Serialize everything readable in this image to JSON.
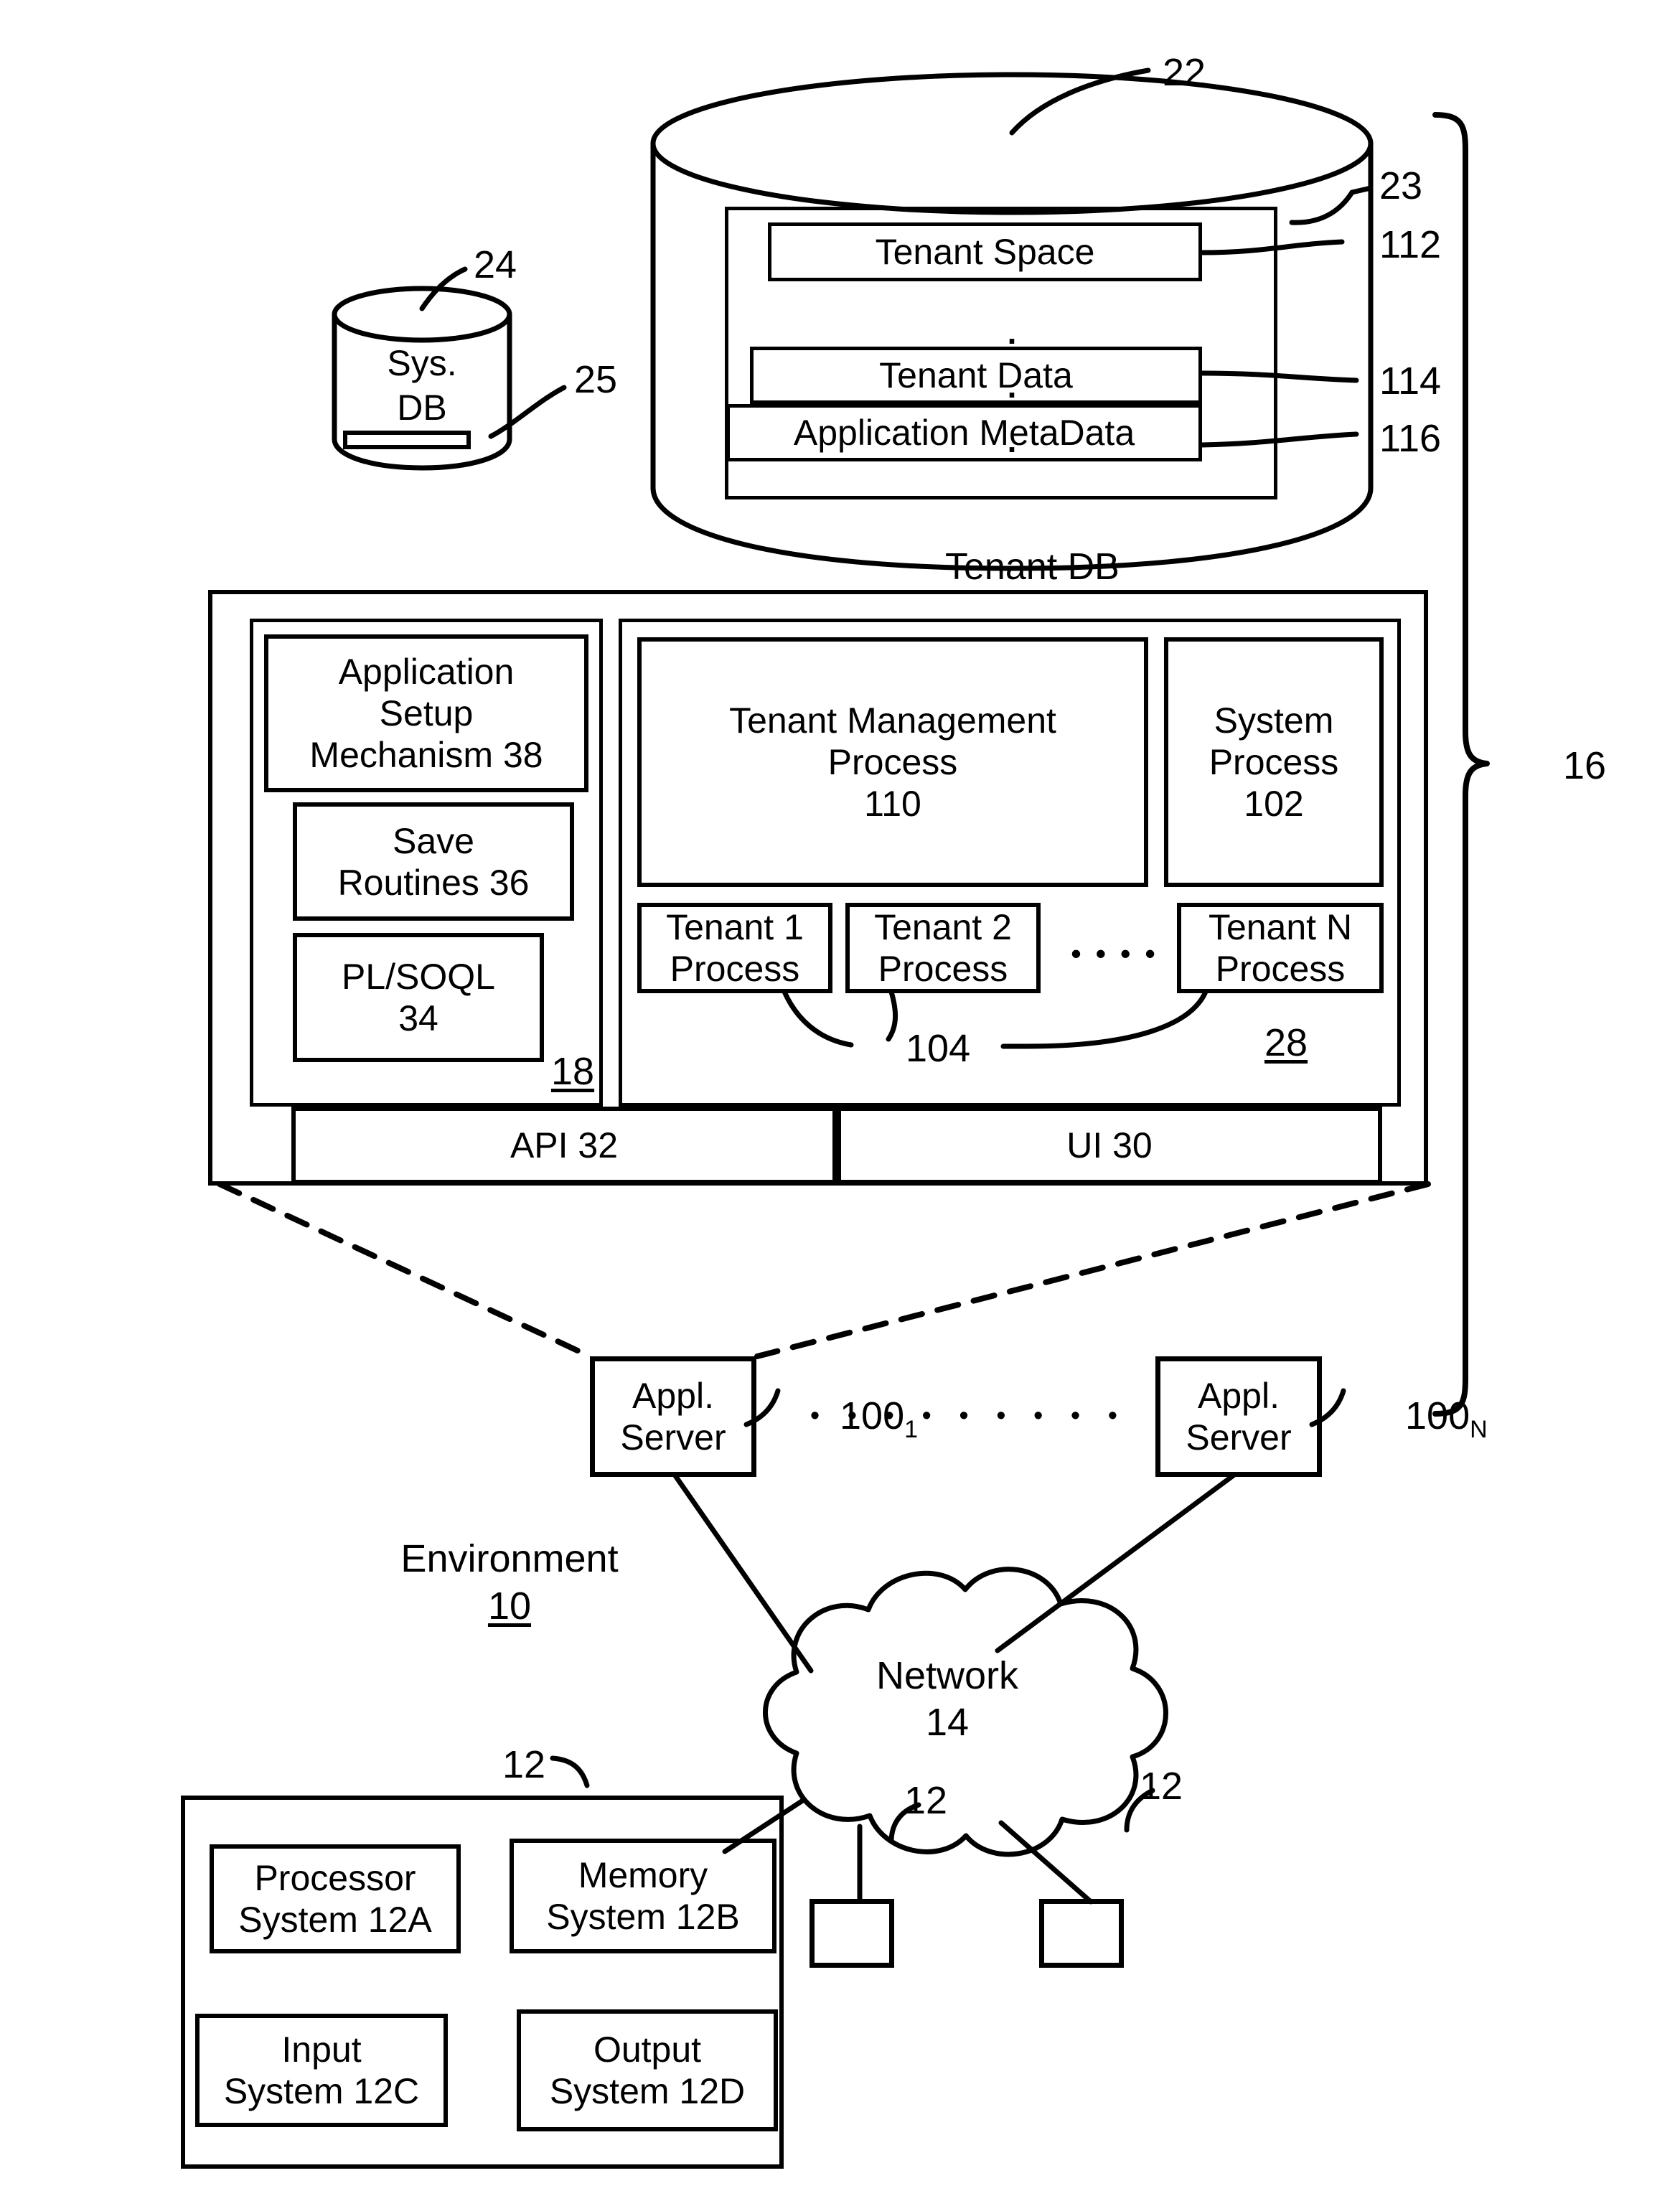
{
  "figure": {
    "type": "patent-system-architecture-diagram",
    "domain": "multi-tenant database system"
  },
  "tenant_db": {
    "cylinder_label": "Tenant DB",
    "ref_cylinder": "22",
    "ref_inner_container": "23",
    "rows": [
      {
        "label": "Tenant Space",
        "ref": "112"
      },
      {
        "label": "Tenant Data",
        "ref": "114"
      },
      {
        "label": "Application MetaData",
        "ref": "116"
      }
    ],
    "ellipsis": "⋮"
  },
  "sys_db": {
    "line1": "Sys.",
    "line2": "DB",
    "ref_cylinder": "24",
    "ref_band": "25"
  },
  "server": {
    "ref_left_group": "18",
    "ref_right_group": "28",
    "left_boxes": [
      {
        "label": "Application\nSetup\nMechanism 38"
      },
      {
        "label": "Save\nRoutines 36"
      },
      {
        "label": "PL/SOQL\n34"
      }
    ],
    "right_top_boxes": [
      {
        "label": "Tenant Management\nProcess\n110"
      },
      {
        "label": "System\nProcess\n102"
      }
    ],
    "tenant_processes": [
      {
        "label": "Tenant 1\nProcess"
      },
      {
        "label": "Tenant 2\nProcess"
      },
      {
        "label": "Tenant N\nProcess"
      }
    ],
    "tenant_process_dots": "• • • •",
    "ref_tenant_process": "104",
    "bottom_bar": [
      {
        "label": "API 32"
      },
      {
        "label": "UI 30"
      }
    ]
  },
  "app_servers": {
    "first": {
      "line1": "Appl.",
      "line2": "Server",
      "ref": "100",
      "ref_sub": "1"
    },
    "last": {
      "line1": "Appl.",
      "line2": "Server",
      "ref": "100",
      "ref_sub": "N"
    },
    "dots": "• • • • • • • • •"
  },
  "environment": {
    "label": "Environment",
    "ref": "10"
  },
  "network": {
    "line1": "Network",
    "line2": "14"
  },
  "system_16": {
    "ref": "16"
  },
  "user_system": {
    "ref": "12",
    "boxes": [
      {
        "label": "Processor\nSystem 12A"
      },
      {
        "label": "Memory\nSystem 12B"
      },
      {
        "label": "Input\nSystem 12C"
      },
      {
        "label": "Output\nSystem 12D"
      }
    ]
  },
  "terminals": [
    {
      "ref": "12"
    },
    {
      "ref": "12"
    }
  ]
}
